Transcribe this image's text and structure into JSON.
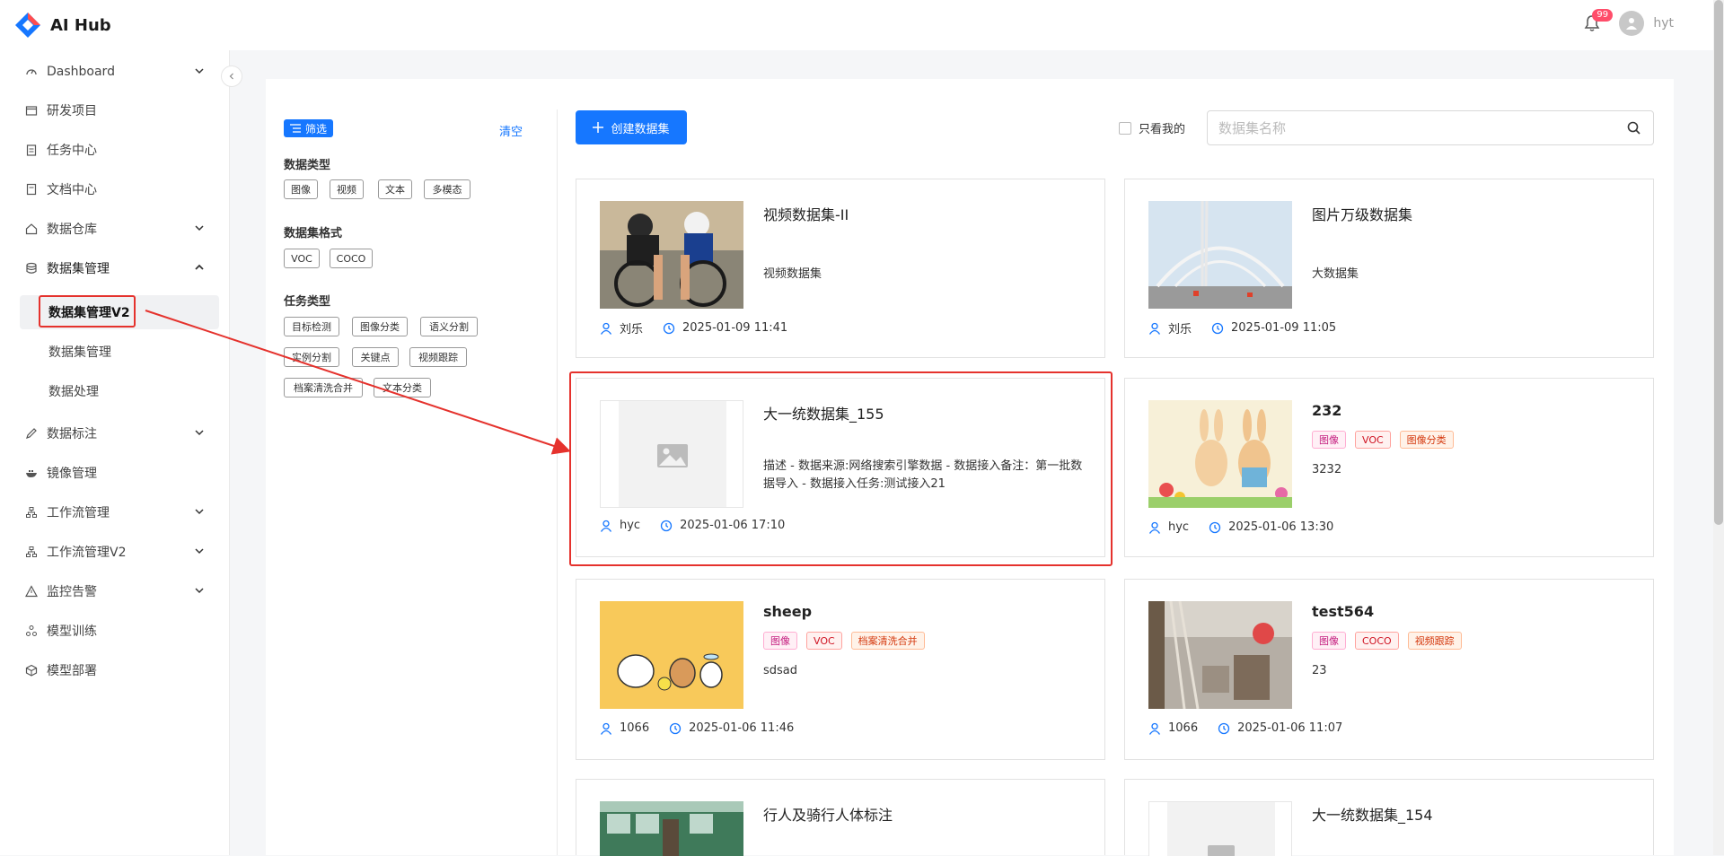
{
  "app": {
    "title": "AI Hub"
  },
  "header": {
    "notification_count": "99",
    "username": "hyt"
  },
  "sidebar": {
    "items": [
      {
        "label": "Dashboard"
      },
      {
        "label": "研发项目"
      },
      {
        "label": "任务中心"
      },
      {
        "label": "文档中心"
      },
      {
        "label": "数据仓库"
      },
      {
        "label": "数据集管理"
      },
      {
        "label": "数据标注"
      },
      {
        "label": "镜像管理"
      },
      {
        "label": "工作流管理"
      },
      {
        "label": "工作流管理V2"
      },
      {
        "label": "监控告警"
      },
      {
        "label": "模型训练"
      },
      {
        "label": "模型部署"
      }
    ],
    "sub_items": [
      {
        "label": "数据集管理V2"
      },
      {
        "label": "数据集管理"
      },
      {
        "label": "数据处理"
      }
    ]
  },
  "filter": {
    "tag_label": "筛选",
    "clear_label": "清空",
    "groups": [
      {
        "title": "数据类型",
        "chips": [
          "图像",
          "视频",
          "文本",
          "多模态"
        ]
      },
      {
        "title": "数据集格式",
        "chips": [
          "VOC",
          "COCO"
        ]
      },
      {
        "title": "任务类型",
        "chips": [
          "目标检测",
          "图像分类",
          "语义分割",
          "实例分割",
          "关键点",
          "视频跟踪",
          "档案清洗合并",
          "文本分类"
        ]
      }
    ]
  },
  "toolbar": {
    "create_label": "创建数据集",
    "only_mine_label": "只看我的",
    "search_placeholder": "数据集名称"
  },
  "datasets": [
    {
      "title": "视频数据集-II",
      "desc": "视频数据集",
      "tags": [],
      "user": "刘乐",
      "time": "2025-01-09 11:41"
    },
    {
      "title": "图片万级数据集",
      "desc": "大数据集",
      "tags": [],
      "user": "刘乐",
      "time": "2025-01-09 11:05"
    },
    {
      "title": "大一统数据集_155",
      "desc": "描述 - 数据来源:网络搜索引擎数据 - 数据接入备注：第一批数据导入 - 数据接入任务:测试接入21",
      "tags": [],
      "user": "hyc",
      "time": "2025-01-06 17:10"
    },
    {
      "title": "232",
      "desc": "3232",
      "tags": [
        "图像",
        "VOC",
        "图像分类"
      ],
      "user": "hyc",
      "time": "2025-01-06 13:30"
    },
    {
      "title": "sheep",
      "desc": "sdsad",
      "tags": [
        "图像",
        "VOC",
        "档案清洗合并"
      ],
      "user": "1066",
      "time": "2025-01-06 11:46"
    },
    {
      "title": "test564",
      "desc": "23",
      "tags": [
        "图像",
        "COCO",
        "视频跟踪"
      ],
      "user": "1066",
      "time": "2025-01-06 11:07"
    },
    {
      "title": "行人及骑行人体标注",
      "desc": "",
      "tags": [],
      "user": "",
      "time": ""
    },
    {
      "title": "大一统数据集_154",
      "desc": "",
      "tags": [],
      "user": "",
      "time": ""
    }
  ]
}
